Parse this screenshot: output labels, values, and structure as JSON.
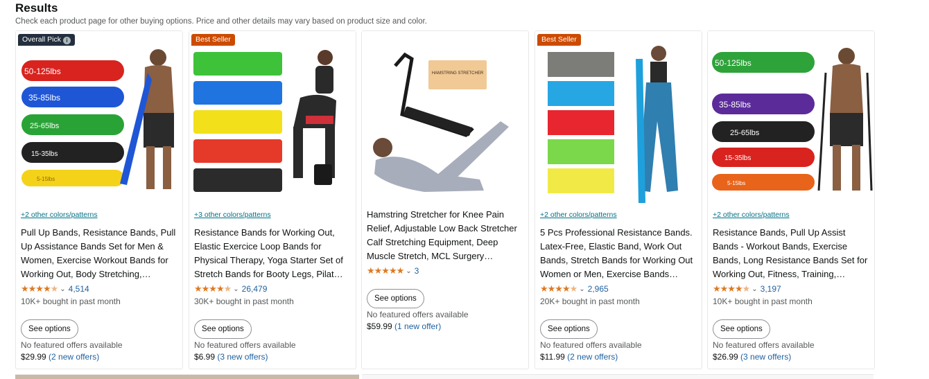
{
  "header": {
    "title": "Results",
    "subtitle": "Check each product page for other buying options. Price and other details may vary based on product size and color."
  },
  "products": [
    {
      "badge": "Overall Pick",
      "colors": "+2 other colors/patterns",
      "title": "Pull Up Bands, Resistance Bands, Pull Up Assistance Bands Set for Men & Women, Exercise Workout Bands for Working Out, Body Stretching,…",
      "reviews": "4,514",
      "bought": "10K+ bought in past month",
      "button": "See options",
      "offer_note": "No featured offers available",
      "price": "$29.99",
      "offers": "(2 new offers)",
      "band_labels": [
        "50-125lbs",
        "35-85lbs",
        "25-65lbs",
        "15-35lbs",
        "5-15lbs"
      ]
    },
    {
      "badge": "Best Seller",
      "colors": "+3 other colors/patterns",
      "title": "Resistance Bands for Working Out, Elastic Exercice Loop Bands for Physical Therapy, Yoga Starter Set of Stretch Bands for Booty Legs, Pilat…",
      "reviews": "26,479",
      "bought": "30K+ bought in past month",
      "button": "See options",
      "offer_note": "No featured offers available",
      "price": "$6.99",
      "offers": "(3 new offers)"
    },
    {
      "badge": "",
      "colors": "",
      "title": "Hamstring Stretcher for Knee Pain Relief, Adjustable Low Back Stretcher Calf Stretching Equipment, Deep Muscle Stretch, MCL Surgery…",
      "reviews": "3",
      "bought": "",
      "button": "See options",
      "offer_note": "No featured offers available",
      "price": "$59.99",
      "offers": "(1 new offer)",
      "box_label": "HAMSTRING STRETCHER"
    },
    {
      "badge": "Best Seller",
      "colors": "+2 other colors/patterns",
      "title": "5 Pcs Professional Resistance Bands. Latex-Free, Elastic Band, Work Out Bands, Stretch Bands for Working Out Women or Men, Exercise Bands…",
      "reviews": "2,965",
      "bought": "20K+ bought in past month",
      "button": "See options",
      "offer_note": "No featured offers available",
      "price": "$11.99",
      "offers": "(2 new offers)"
    },
    {
      "badge": "",
      "colors": "+2 other colors/patterns",
      "title": "Resistance Bands, Pull Up Assist Bands - Workout Bands, Exercise Bands, Long Resistance Bands Set for Working Out, Fitness, Training,…",
      "reviews": "3,197",
      "bought": "10K+ bought in past month",
      "button": "See options",
      "offer_note": "No featured offers available",
      "price": "$26.99",
      "offers": "(3 new offers)",
      "band_labels": [
        "50-125lbs",
        "35-85lbs",
        "25-65lbs",
        "15-35lbs",
        "5-15lbs"
      ]
    }
  ],
  "colors": {
    "link": "#007185",
    "star": "#de7921",
    "best_seller": "#cc4b00",
    "overall_pick": "#232f3e"
  }
}
